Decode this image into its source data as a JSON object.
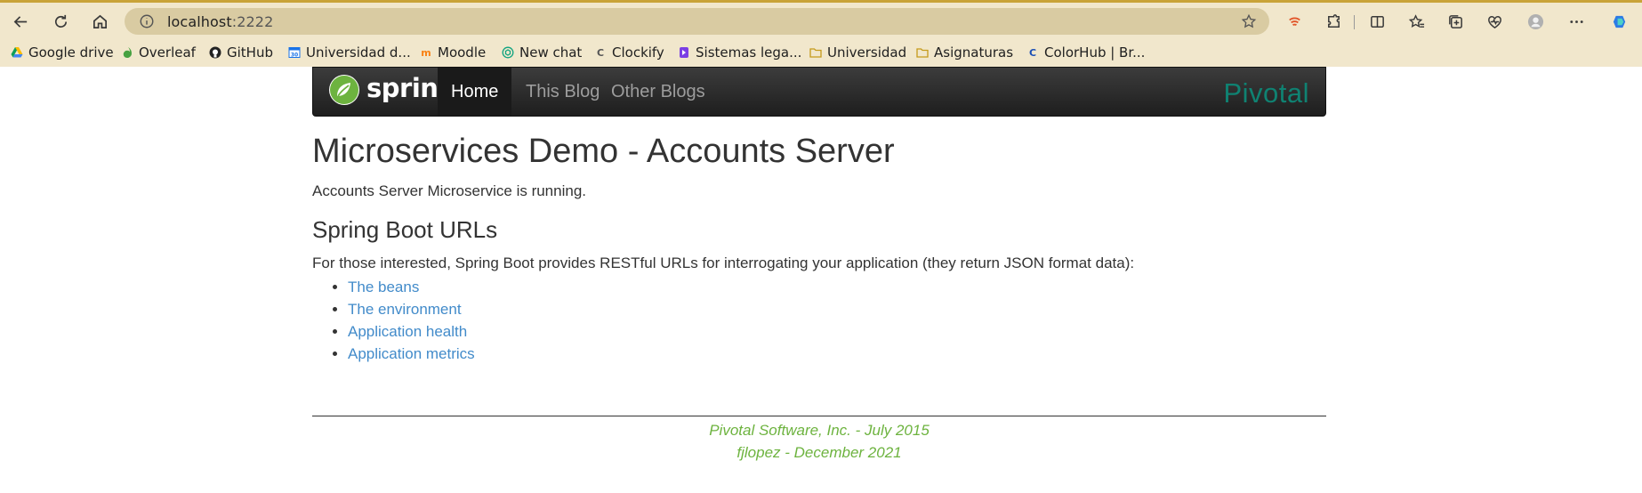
{
  "browser": {
    "url_host": "localhost",
    "url_port": ":2222",
    "bookmarks": [
      {
        "label": "Google drive",
        "icon": "google-drive-icon"
      },
      {
        "label": "Overleaf",
        "icon": "overleaf-icon"
      },
      {
        "label": "GitHub",
        "icon": "github-icon"
      },
      {
        "label": "Universidad d...",
        "icon": "calendar-icon"
      },
      {
        "label": "Moodle",
        "icon": "moodle-icon"
      },
      {
        "label": "New chat",
        "icon": "chatgpt-icon"
      },
      {
        "label": "Clockify",
        "icon": "clockify-icon"
      },
      {
        "label": "Sistemas lega...",
        "icon": "app-icon"
      },
      {
        "label": "Universidad",
        "icon": "folder-icon"
      },
      {
        "label": "Asignaturas",
        "icon": "folder-icon"
      },
      {
        "label": "ColorHub | Br...",
        "icon": "colorhub-icon"
      }
    ],
    "colors": {
      "chrome_bg": "#f1e7cc",
      "omnibox_bg": "#d9cba2",
      "accent": "#c9a338"
    }
  },
  "navbar": {
    "brand": "spring",
    "items": [
      {
        "label": "Home",
        "active": true
      },
      {
        "label": "This Blog",
        "active": false
      },
      {
        "label": "Other Blogs",
        "active": false
      }
    ],
    "right_brand": "Pivotal",
    "colors": {
      "spring_green": "#6db33f",
      "pivotal_teal": "#0f8272"
    }
  },
  "main": {
    "title": "Microservices Demo - Accounts Server",
    "status": "Accounts Server Microservice is running.",
    "section_title": "Spring Boot URLs",
    "intro": "For those interested, Spring Boot provides RESTful URLs for interrogating your application (they return JSON format data):",
    "links": [
      {
        "label": "The beans"
      },
      {
        "label": "The environment"
      },
      {
        "label": "Application health"
      },
      {
        "label": "Application metrics"
      }
    ]
  },
  "footer": {
    "line1": "Pivotal Software, Inc. - July 2015",
    "line2": "fjlopez - December 2021",
    "color": "#6db33f"
  }
}
